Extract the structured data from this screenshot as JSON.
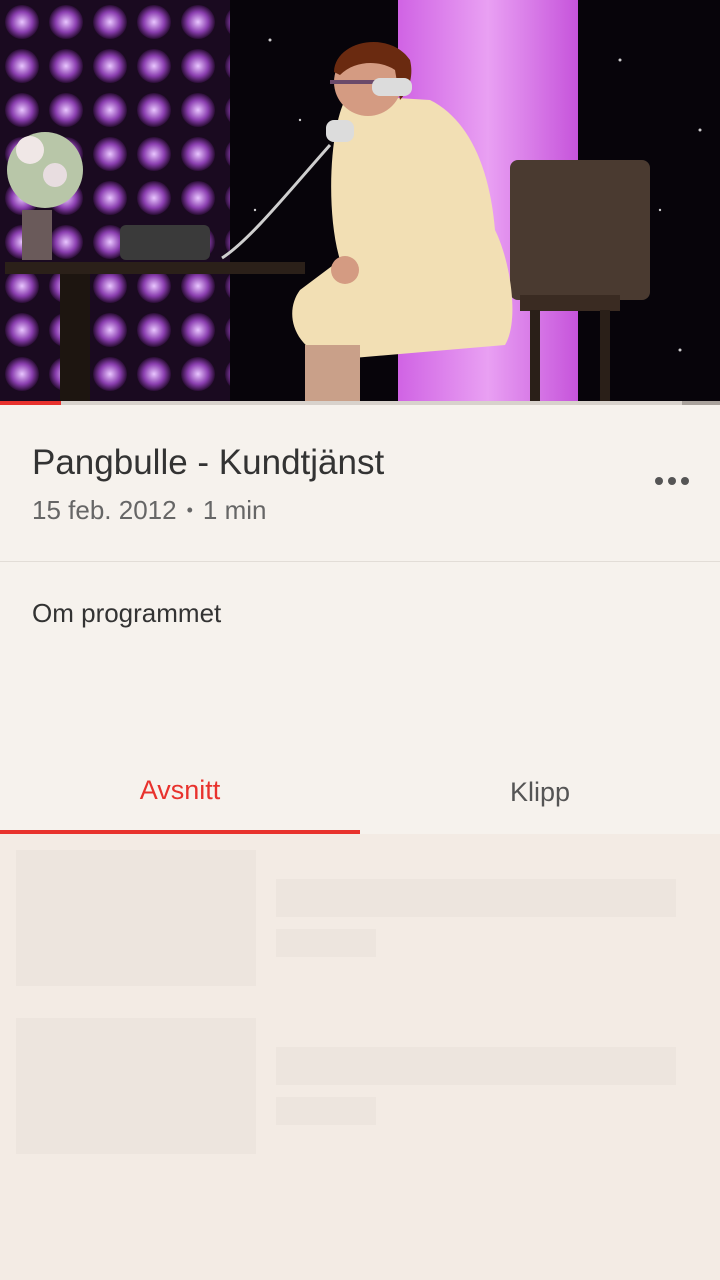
{
  "player": {
    "progress_fraction": 0.085
  },
  "episode": {
    "title": "Pangbulle - Kundtjänst",
    "date": "15 feb. 2012",
    "separator": "•",
    "duration": "1 min"
  },
  "about": {
    "label": "Om programmet"
  },
  "tabs": [
    {
      "label": "Avsnitt",
      "active": true
    },
    {
      "label": "Klipp",
      "active": false
    }
  ],
  "colors": {
    "accent": "#e8322d",
    "background": "#f6f2ed",
    "placeholder": "#ede5de"
  },
  "icons": {
    "more": "more-horizontal-icon"
  }
}
